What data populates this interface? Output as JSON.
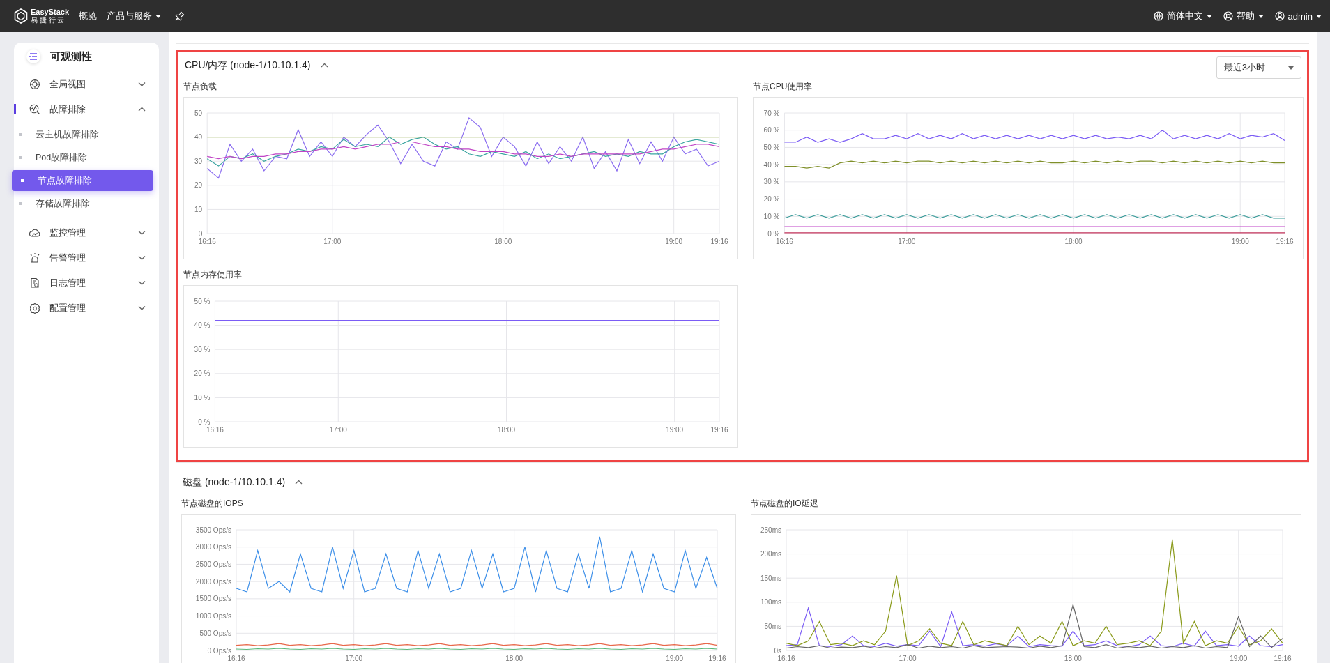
{
  "topbar": {
    "logo_text": "EasyStack",
    "logo_subtext": "易 捷 行 云",
    "nav": [
      {
        "label": "概览",
        "dropdown": false
      },
      {
        "label": "产品与服务",
        "dropdown": true
      }
    ],
    "right": [
      {
        "label": "简体中文"
      },
      {
        "label": "帮助"
      },
      {
        "label": "admin"
      }
    ]
  },
  "sidebar": {
    "title": "可观测性",
    "items": [
      {
        "label": "全局视图",
        "expanded": false
      },
      {
        "label": "故障排除",
        "expanded": true,
        "children": [
          {
            "label": "云主机故障排除",
            "selected": false
          },
          {
            "label": "Pod故障排除",
            "selected": false
          },
          {
            "label": "节点故障排除",
            "selected": true
          },
          {
            "label": "存储故障排除",
            "selected": false
          }
        ]
      },
      {
        "label": "监控管理",
        "expanded": false
      },
      {
        "label": "告警管理",
        "expanded": false
      },
      {
        "label": "日志管理",
        "expanded": false
      },
      {
        "label": "配置管理",
        "expanded": false
      }
    ]
  },
  "sections": [
    {
      "title": "CPU/内存 (node-1/10.10.1.4)",
      "expanded": true,
      "highlighted": true,
      "time_range": "最近3小时",
      "charts": [
        {
          "chart_data": {
            "type": "line",
            "title": "节点负载",
            "grid": true,
            "categories": [
              "16:16",
              null,
              null,
              null,
              null,
              null,
              null,
              null,
              null,
              null,
              null,
              "17:00",
              null,
              null,
              null,
              null,
              null,
              null,
              null,
              null,
              null,
              null,
              null,
              null,
              null,
              null,
              "18:00",
              null,
              null,
              null,
              null,
              null,
              null,
              null,
              null,
              null,
              null,
              null,
              null,
              null,
              null,
              "19:00",
              null,
              null,
              null,
              "19:16"
            ],
            "ylim": [
              0,
              50
            ],
            "yticks": [
              0,
              10,
              20,
              30,
              40,
              50
            ],
            "series": [
              {
                "color": "#8a6cf0",
                "values": [
                  27,
                  23,
                  37,
                  30,
                  35,
                  26,
                  32,
                  31,
                  43,
                  32,
                  38,
                  32,
                  40,
                  36,
                  41,
                  45,
                  38,
                  29,
                  37,
                  30,
                  28,
                  38,
                  35,
                  48,
                  44,
                  32,
                  40,
                  36,
                  28,
                  38,
                  29,
                  36,
                  30,
                  40,
                  27,
                  34,
                  26,
                  39,
                  29,
                  38,
                  30,
                  40,
                  33,
                  35,
                  28,
                  30
                ]
              },
              {
                "color": "#3aa5a0",
                "values": [
                  31,
                  28,
                  32,
                  31,
                  33,
                  30,
                  32,
                  33,
                  35,
                  34,
                  36,
                  35,
                  39,
                  36,
                  37,
                  36,
                  40,
                  37,
                  39,
                  40,
                  37,
                  35,
                  36,
                  33,
                  32,
                  34,
                  33,
                  32,
                  34,
                  31,
                  33,
                  31,
                  32,
                  33,
                  34,
                  32,
                  33,
                  32,
                  34,
                  33,
                  33,
                  36,
                  38,
                  39,
                  38,
                  37
                ]
              },
              {
                "color": "#c044c6",
                "values": [
                  32,
                  31,
                  32,
                  31,
                  32,
                  32,
                  33,
                  33,
                  34,
                  34,
                  35,
                  35,
                  36,
                  35,
                  36,
                  37,
                  37,
                  38,
                  38,
                  37,
                  36,
                  36,
                  35,
                  35,
                  34,
                  34,
                  34,
                  33,
                  33,
                  32,
                  32,
                  33,
                  32,
                  33,
                  33,
                  33,
                  33,
                  33,
                  33,
                  34,
                  35,
                  35,
                  36,
                  37,
                  37,
                  36
                ]
              },
              {
                "color": "#9cb35a",
                "values": [
                  40,
                  40,
                  40,
                  40,
                  40,
                  40,
                  40,
                  40,
                  40,
                  40,
                  40,
                  40,
                  40,
                  40,
                  40,
                  40,
                  40,
                  40,
                  40,
                  40,
                  40,
                  40,
                  40,
                  40,
                  40,
                  40,
                  40,
                  40,
                  40,
                  40,
                  40,
                  40,
                  40,
                  40,
                  40,
                  40,
                  40,
                  40,
                  40,
                  40,
                  40,
                  40,
                  40,
                  40,
                  40,
                  40
                ]
              }
            ]
          }
        },
        {
          "chart_data": {
            "type": "line",
            "title": "节点CPU使用率",
            "grid": true,
            "categories": [
              "16:16",
              null,
              null,
              null,
              null,
              null,
              null,
              null,
              null,
              null,
              null,
              "17:00",
              null,
              null,
              null,
              null,
              null,
              null,
              null,
              null,
              null,
              null,
              null,
              null,
              null,
              null,
              "18:00",
              null,
              null,
              null,
              null,
              null,
              null,
              null,
              null,
              null,
              null,
              null,
              null,
              null,
              null,
              "19:00",
              null,
              null,
              null,
              "19:16"
            ],
            "ylim": [
              0,
              70
            ],
            "yticks": [
              {
                "value": 0,
                "label": "0 %"
              },
              {
                "value": 10,
                "label": "10 %"
              },
              {
                "value": 20,
                "label": "20 %"
              },
              {
                "value": 30,
                "label": "30 %"
              },
              {
                "value": 40,
                "label": "40 %"
              },
              {
                "value": 50,
                "label": "50 %"
              },
              {
                "value": 60,
                "label": "60 %"
              },
              {
                "value": 70,
                "label": "70 %"
              }
            ],
            "series": [
              {
                "color": "#7b5cf5",
                "values": [
                  53,
                  53,
                  56,
                  53,
                  55,
                  53,
                  55,
                  58,
                  55,
                  55,
                  57,
                  55,
                  58,
                  55,
                  57,
                  55,
                  58,
                  55,
                  57,
                  55,
                  57,
                  55,
                  57,
                  55,
                  57,
                  55,
                  57,
                  55,
                  57,
                  55,
                  56,
                  55,
                  57,
                  55,
                  60,
                  55,
                  57,
                  55,
                  57,
                  55,
                  58,
                  55,
                  57,
                  56,
                  58,
                  54
                ]
              },
              {
                "color": "#7f8f2a",
                "values": [
                  39,
                  39,
                  38,
                  39,
                  38,
                  41,
                  42,
                  41,
                  42,
                  41,
                  42,
                  41,
                  42,
                  42,
                  41,
                  42,
                  41,
                  42,
                  41,
                  42,
                  41,
                  42,
                  41,
                  42,
                  41,
                  41,
                  42,
                  41,
                  42,
                  41,
                  42,
                  41,
                  42,
                  42,
                  41,
                  42,
                  41,
                  42,
                  41,
                  42,
                  41,
                  42,
                  41,
                  42,
                  41,
                  41
                ]
              },
              {
                "color": "#3a9c9a",
                "values": [
                  9,
                  11,
                  9,
                  11,
                  9,
                  11,
                  9,
                  11,
                  9,
                  11,
                  9,
                  11,
                  9,
                  11,
                  9,
                  11,
                  9,
                  11,
                  9,
                  11,
                  9,
                  11,
                  9,
                  11,
                  9,
                  11,
                  9,
                  11,
                  9,
                  11,
                  9,
                  11,
                  9,
                  11,
                  9,
                  11,
                  9,
                  11,
                  9,
                  11,
                  9,
                  11,
                  9,
                  11,
                  9,
                  9
                ]
              },
              {
                "color": "#c042c8",
                "values": [
                  4,
                  4,
                  4,
                  4,
                  4,
                  4,
                  4,
                  4,
                  4,
                  4,
                  4,
                  4,
                  4,
                  4,
                  4,
                  4,
                  4,
                  4,
                  4,
                  4,
                  4,
                  4,
                  4,
                  4,
                  4,
                  4,
                  4,
                  4,
                  4,
                  4,
                  4,
                  4,
                  4,
                  4,
                  4,
                  4,
                  4,
                  4,
                  4,
                  4,
                  4,
                  4,
                  4,
                  4,
                  4,
                  4
                ]
              },
              {
                "color": "#c2325a",
                "values": [
                  0.5,
                  0.5,
                  0.5,
                  0.5,
                  0.5,
                  0.5,
                  0.5,
                  0.5,
                  0.5,
                  0.5,
                  0.5,
                  0.5,
                  0.5,
                  0.5,
                  0.5,
                  0.5,
                  0.5,
                  0.5,
                  0.5,
                  0.5,
                  0.5,
                  0.5,
                  0.5,
                  0.5,
                  0.5,
                  0.5,
                  0.5,
                  0.5,
                  0.5,
                  0.5,
                  0.5,
                  0.5,
                  0.5,
                  0.5,
                  0.5,
                  0.5,
                  0.5,
                  0.5,
                  0.5,
                  0.5,
                  0.5,
                  0.5,
                  0.5,
                  0.5,
                  0.5,
                  0.5
                ]
              }
            ]
          }
        },
        {
          "chart_data": {
            "type": "line",
            "title": "节点内存使用率",
            "grid": true,
            "categories": [
              "16:16",
              null,
              null,
              null,
              null,
              null,
              null,
              null,
              null,
              null,
              null,
              "17:00",
              null,
              null,
              null,
              null,
              null,
              null,
              null,
              null,
              null,
              null,
              null,
              null,
              null,
              null,
              "18:00",
              null,
              null,
              null,
              null,
              null,
              null,
              null,
              null,
              null,
              null,
              null,
              null,
              null,
              null,
              "19:00",
              null,
              null,
              null,
              "19:16"
            ],
            "ylim": [
              0,
              50
            ],
            "yticks": [
              {
                "value": 0,
                "label": "0 %"
              },
              {
                "value": 10,
                "label": "10 %"
              },
              {
                "value": 20,
                "label": "20 %"
              },
              {
                "value": 30,
                "label": "30 %"
              },
              {
                "value": 40,
                "label": "40 %"
              },
              {
                "value": 50,
                "label": "50 %"
              }
            ],
            "series": [
              {
                "color": "#7b5cf5",
                "values": [
                  42,
                  42,
                  42,
                  42,
                  42,
                  42,
                  42,
                  42,
                  42,
                  42,
                  42,
                  42,
                  42,
                  42,
                  42,
                  42,
                  42,
                  42,
                  42,
                  42,
                  42,
                  42,
                  42,
                  42,
                  42,
                  42,
                  42,
                  42,
                  42,
                  42,
                  42,
                  42,
                  42,
                  42,
                  42,
                  42,
                  42,
                  42,
                  42,
                  42,
                  42,
                  42,
                  42,
                  42,
                  42,
                  42
                ]
              }
            ]
          }
        }
      ]
    },
    {
      "title": "磁盘 (node-1/10.10.1.4)",
      "expanded": true,
      "highlighted": false,
      "charts": [
        {
          "chart_data": {
            "type": "line",
            "title": "节点磁盘的IOPS",
            "grid": true,
            "categories": [
              "16:16",
              null,
              null,
              null,
              null,
              null,
              null,
              null,
              null,
              null,
              null,
              "17:00",
              null,
              null,
              null,
              null,
              null,
              null,
              null,
              null,
              null,
              null,
              null,
              null,
              null,
              null,
              "18:00",
              null,
              null,
              null,
              null,
              null,
              null,
              null,
              null,
              null,
              null,
              null,
              null,
              null,
              null,
              "19:00",
              null,
              null,
              null,
              "19:16"
            ],
            "ylim": [
              0,
              3500
            ],
            "yticks": [
              {
                "value": 0,
                "label": "0 Ops/s"
              },
              {
                "value": 500,
                "label": "500 Ops/s"
              },
              {
                "value": 1000,
                "label": "1000 Ops/s"
              },
              {
                "value": 1500,
                "label": "1500 Ops/s"
              },
              {
                "value": 2000,
                "label": "2000 Ops/s"
              },
              {
                "value": 2500,
                "label": "2500 Ops/s"
              },
              {
                "value": 3000,
                "label": "3000 Ops/s"
              },
              {
                "value": 3500,
                "label": "3500 Ops/s"
              }
            ],
            "series": [
              {
                "color": "#3d8fe8",
                "values": [
                  1800,
                  1700,
                  2900,
                  1800,
                  2000,
                  1700,
                  2800,
                  1800,
                  1700,
                  3000,
                  1800,
                  2900,
                  1700,
                  1800,
                  2800,
                  1800,
                  1700,
                  2900,
                  1800,
                  2800,
                  1700,
                  1800,
                  2900,
                  1800,
                  2800,
                  1700,
                  1800,
                  3000,
                  1700,
                  2900,
                  1800,
                  1700,
                  2800,
                  1800,
                  3300,
                  1700,
                  1800,
                  2900,
                  1700,
                  2800,
                  1800,
                  1700,
                  2900,
                  1800,
                  2700,
                  1800
                ]
              },
              {
                "color": "#e8684a",
                "values": [
                  150,
                  170,
                  140,
                  160,
                  200,
                  150,
                  170,
                  140,
                  160,
                  200,
                  150,
                  170,
                  140,
                  160,
                  200,
                  150,
                  170,
                  140,
                  160,
                  200,
                  150,
                  170,
                  140,
                  160,
                  200,
                  150,
                  170,
                  140,
                  160,
                  200,
                  150,
                  170,
                  140,
                  160,
                  200,
                  150,
                  170,
                  140,
                  160,
                  200,
                  150,
                  170,
                  140,
                  160,
                  200,
                  150
                ]
              },
              {
                "color": "#5ab87a",
                "values": [
                  40,
                  30,
                  50,
                  40,
                  60,
                  40,
                  30,
                  50,
                  40,
                  60,
                  40,
                  30,
                  50,
                  40,
                  60,
                  40,
                  30,
                  50,
                  40,
                  60,
                  40,
                  30,
                  50,
                  40,
                  60,
                  40,
                  30,
                  50,
                  40,
                  60,
                  40,
                  30,
                  50,
                  40,
                  60,
                  40,
                  30,
                  50,
                  40,
                  60,
                  40,
                  30,
                  50,
                  40,
                  60,
                  40
                ]
              }
            ]
          }
        },
        {
          "chart_data": {
            "type": "line",
            "title": "节点磁盘的IO延迟",
            "grid": true,
            "categories": [
              "16:16",
              null,
              null,
              null,
              null,
              null,
              null,
              null,
              null,
              null,
              null,
              "17:00",
              null,
              null,
              null,
              null,
              null,
              null,
              null,
              null,
              null,
              null,
              null,
              null,
              null,
              null,
              "18:00",
              null,
              null,
              null,
              null,
              null,
              null,
              null,
              null,
              null,
              null,
              null,
              null,
              null,
              null,
              "19:00",
              null,
              null,
              null,
              "19:16"
            ],
            "ylim": [
              0,
              250
            ],
            "yticks": [
              {
                "value": 0,
                "label": "0s"
              },
              {
                "value": 50,
                "label": "50ms"
              },
              {
                "value": 100,
                "label": "100ms"
              },
              {
                "value": 150,
                "label": "150ms"
              },
              {
                "value": 200,
                "label": "200ms"
              },
              {
                "value": 250,
                "label": "250ms"
              }
            ],
            "series": [
              {
                "color": "#7b5cf5",
                "values": [
                  10,
                  12,
                  88,
                  10,
                  8,
                  12,
                  30,
                  10,
                  8,
                  15,
                  9,
                  12,
                  10,
                  40,
                  8,
                  80,
                  10,
                  12,
                  9,
                  14,
                  10,
                  30,
                  8,
                  12,
                  10,
                  9,
                  40,
                  10,
                  12,
                  20,
                  10,
                  8,
                  12,
                  30,
                  10,
                  8,
                  15,
                  9,
                  40,
                  10,
                  12,
                  9,
                  30,
                  10,
                  8,
                  12
                ]
              },
              {
                "color": "#8a9a1a",
                "values": [
                  15,
                  10,
                  20,
                  60,
                  12,
                  15,
                  10,
                  20,
                  12,
                  40,
                  155,
                  10,
                  20,
                  45,
                  15,
                  10,
                  60,
                  12,
                  20,
                  15,
                  10,
                  50,
                  12,
                  30,
                  15,
                  60,
                  10,
                  20,
                  15,
                  50,
                  12,
                  15,
                  20,
                  10,
                  40,
                  230,
                  15,
                  60,
                  10,
                  20,
                  15,
                  50,
                  12,
                  20,
                  45,
                  15
                ]
              },
              {
                "color": "#666666",
                "values": [
                  5,
                  8,
                  6,
                  10,
                  5,
                  7,
                  6,
                  9,
                  5,
                  8,
                  6,
                  12,
                  5,
                  9,
                  6,
                  8,
                  5,
                  10,
                  6,
                  7,
                  8,
                  7,
                  5,
                  9,
                  6,
                  10,
                  95,
                  8,
                  6,
                  12,
                  5,
                  8,
                  6,
                  9,
                  5,
                  8,
                  6,
                  10,
                  5,
                  8,
                  6,
                  70,
                  8,
                  30,
                  6,
                  25
                ]
              }
            ]
          }
        }
      ]
    }
  ]
}
